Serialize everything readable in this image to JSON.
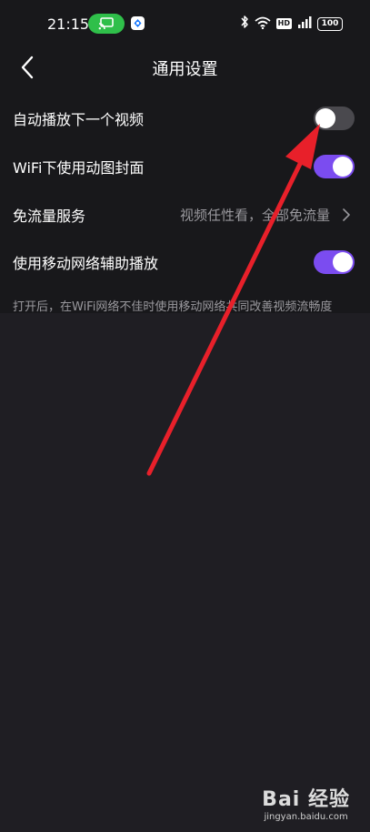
{
  "status_bar": {
    "time": "21:15",
    "cast_icon": "screen-cast-icon",
    "battery": "100",
    "network_badge": "HD",
    "icons": [
      "bluetooth-icon",
      "wifi-icon",
      "signal-icon",
      "battery-icon"
    ]
  },
  "header": {
    "title": "通用设置",
    "back_icon": "chevron-left-icon"
  },
  "settings": [
    {
      "label": "自动播放下一个视频",
      "type": "toggle",
      "on": false
    },
    {
      "label": "WiFi下使用动图封面",
      "type": "toggle",
      "on": true
    },
    {
      "label": "免流量服务",
      "type": "link",
      "value": "视频任性看，全部免流量"
    },
    {
      "label": "使用移动网络辅助播放",
      "type": "toggle",
      "on": true
    }
  ],
  "hint": "打开后，在WiFi网络不佳时使用移动网络共同改善视频流畅度",
  "colors": {
    "toggle_on": "#7b4cf0",
    "toggle_off": "#4a494e",
    "annotation_arrow": "#e8202a",
    "cast_pill": "#2fbf4a"
  },
  "watermark": {
    "logo": "Bai 经验",
    "url": "jingyan.baidu.com"
  }
}
